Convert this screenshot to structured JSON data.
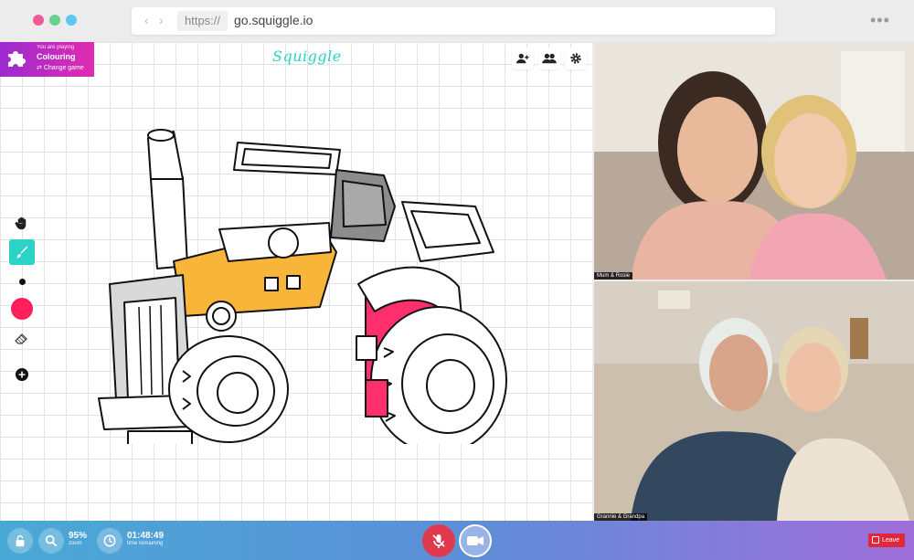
{
  "browser": {
    "scheme": "https://",
    "url": "go.squiggle.io",
    "back_icon": "chevron-left-icon",
    "forward_icon": "chevron-right-icon",
    "menu_icon": "more-horizontal-icon"
  },
  "game": {
    "playing_label": "You are playing",
    "title": "Colouring",
    "change_label": "Change game",
    "icon": "puzzle-icon"
  },
  "app": {
    "logo": "Squiggle",
    "accent": "#2bcfc7"
  },
  "top_actions": [
    {
      "icon": "add-user-icon"
    },
    {
      "icon": "users-icon"
    },
    {
      "icon": "gear-icon"
    }
  ],
  "tools": [
    {
      "icon": "hand-icon"
    },
    {
      "icon": "brush-icon",
      "active": true
    },
    {
      "icon": "brush-size-icon"
    },
    {
      "icon": "color-swatch-icon",
      "color": "#ff1f5a"
    },
    {
      "icon": "eraser-icon"
    },
    {
      "icon": "plus-icon"
    }
  ],
  "drawing": {
    "paint_colors": [
      "#f5b431",
      "#ff2e6c",
      "#8a8a8a"
    ]
  },
  "videos": [
    {
      "name": "Mum & Rosie"
    },
    {
      "name": "Grannie & Grandpa"
    }
  ],
  "bottom": {
    "zoom_value": "95%",
    "zoom_label": "zoom",
    "time_value": "01:48:49",
    "time_label": "time remaining",
    "leave_label": "Leave",
    "mic_color": "#e03a50",
    "leave_color": "#e0283c"
  }
}
